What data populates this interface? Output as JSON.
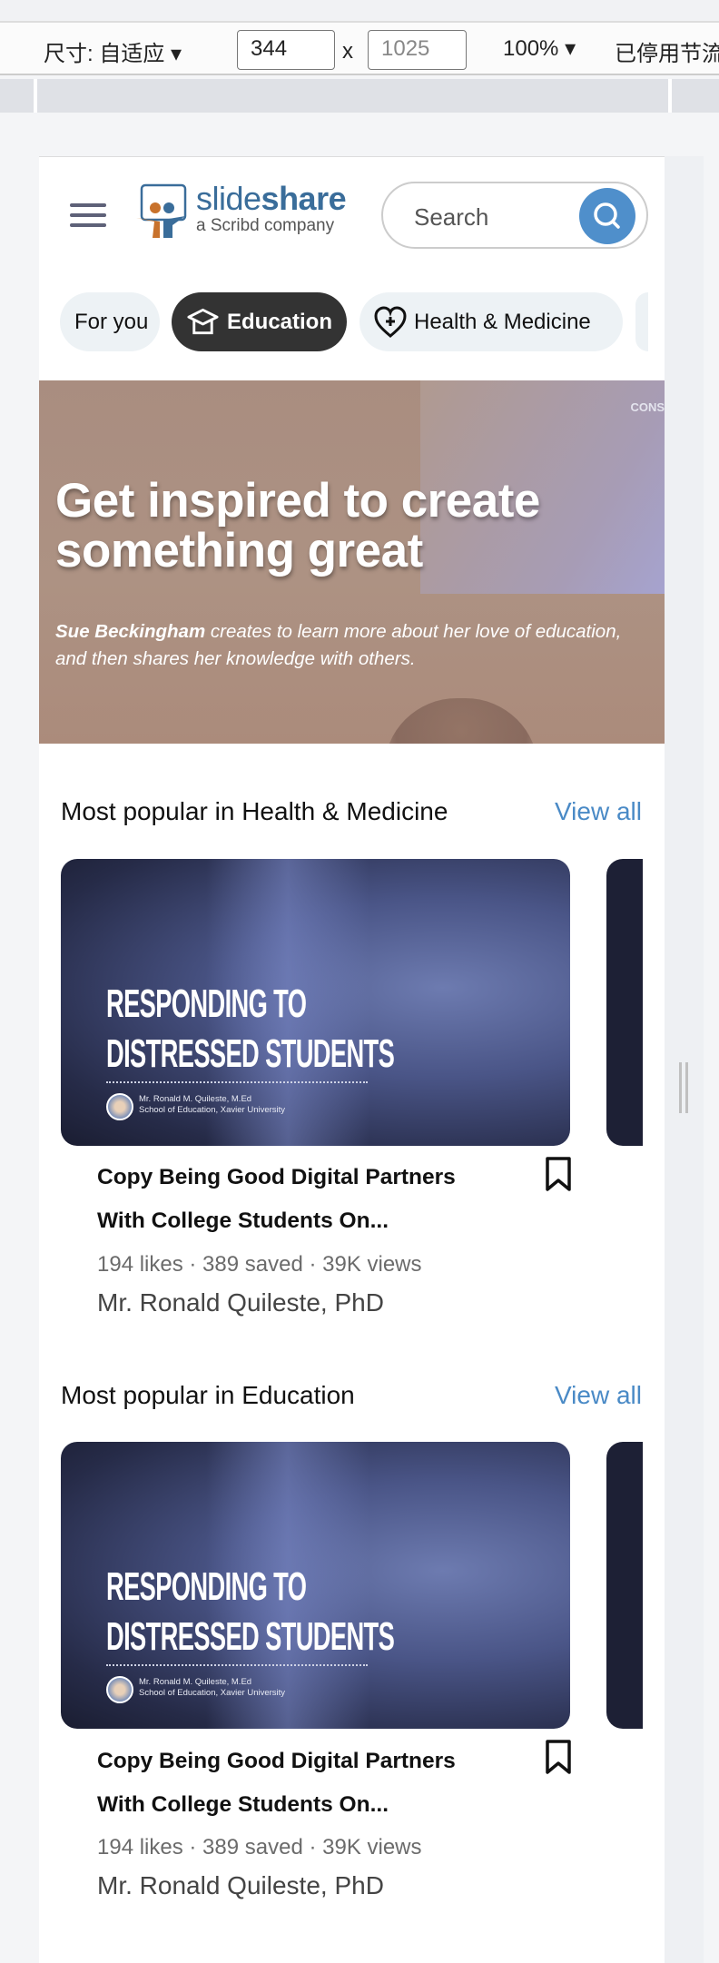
{
  "devtools": {
    "size_label": "尺寸: 自适应",
    "width": "344",
    "height": "1025",
    "times": "x",
    "zoom": "100%",
    "throttle": "已停用节流"
  },
  "header": {
    "logo_text_light": "slide",
    "logo_text_bold": "share",
    "logo_sub": "a Scribd company",
    "search_placeholder": "Search",
    "search_button_color": "#4f8fcb"
  },
  "chips": [
    {
      "label": "For you"
    },
    {
      "label": "Education",
      "icon": "graduation-cap-icon",
      "active": true
    },
    {
      "label": "Health & Medicine",
      "icon": "heart-plus-icon"
    }
  ],
  "hero": {
    "title": "Get inspired to create something great",
    "name": "Sue Beckingham",
    "text": " creates to learn more about her love of education, and then shares her knowledge with others.",
    "corner": "CONS"
  },
  "sections": [
    {
      "title": "Most popular in Health & Medicine",
      "view_all": "View all",
      "card": {
        "thumb_line1": "RESPONDING TO",
        "thumb_line2": "DISTRESSED STUDENTS",
        "thumb_by1": "Mr. Ronald M. Quileste, M.Ed",
        "thumb_by2": "School of Education, Xavier University",
        "title_line1": "Copy Being Good Digital Partners",
        "title_line2": "With College Students On...",
        "stats": "194 likes · 389 saved · 39K views",
        "author": "Mr. Ronald Quileste, PhD"
      }
    },
    {
      "title": "Most popular in Education",
      "view_all": "View all",
      "card": {
        "thumb_line1": "RESPONDING TO",
        "thumb_line2": "DISTRESSED STUDENTS",
        "thumb_by1": "Mr. Ronald M. Quileste, M.Ed",
        "thumb_by2": "School of Education, Xavier University",
        "title_line1": "Copy Being Good Digital Partners",
        "title_line2": "With College Students On...",
        "stats": "194 likes · 389 saved · 39K views",
        "author": "Mr. Ronald Quileste, PhD"
      }
    }
  ]
}
